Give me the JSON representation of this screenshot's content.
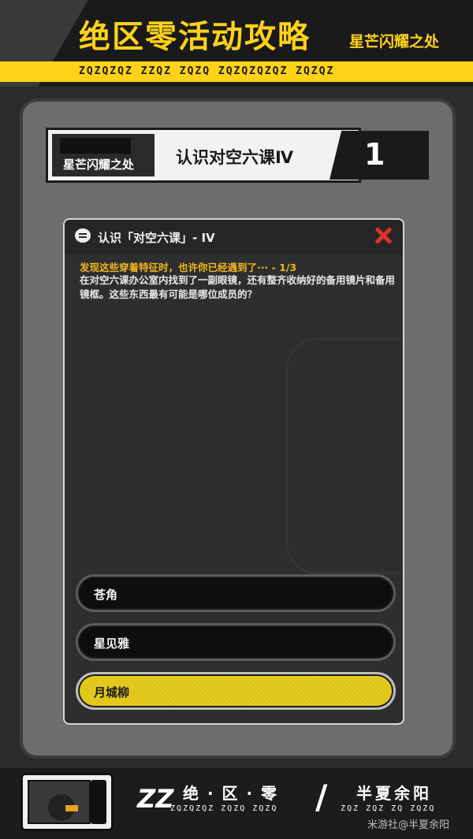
{
  "header": {
    "title": "绝区零活动攻略",
    "subtitle": "星芒闪耀之处",
    "band_text": "ZQZQZQZ ZZQZ ZQZQ ZQZQZQZQZ ZQZQZ"
  },
  "plate": {
    "location": "星芒闪耀之处",
    "quest_name": "认识对空六课Ⅳ",
    "number": "1"
  },
  "dialog": {
    "title": "认识「对空六课」- IV",
    "question_heading": "发现这些穿着特征时，也许你已经遇到了··· - 1/3",
    "question_body": "在对空六课办公室内找到了一副眼镜，还有整齐收纳好的备用镜片和备用镜框。这些东西最有可能是哪位成员的？",
    "options": [
      {
        "label": "苍角",
        "selected": false
      },
      {
        "label": "星见雅",
        "selected": false
      },
      {
        "label": "月城柳",
        "selected": true
      }
    ]
  },
  "footer": {
    "logo": "ZZ",
    "game_name": "绝 · 区 · 零",
    "game_name_en": "ZQZQZQZ ZQZQ ZQZQ",
    "slash": "/",
    "author": "半夏余阳",
    "author_en": "ZQZ ZQZ ZQ ZQZQ"
  },
  "watermark": "米游社@半夏余阳",
  "colors": {
    "accent_yellow": "#ffd21a",
    "close_red": "#e0322c",
    "question_heading": "#f0b820"
  }
}
